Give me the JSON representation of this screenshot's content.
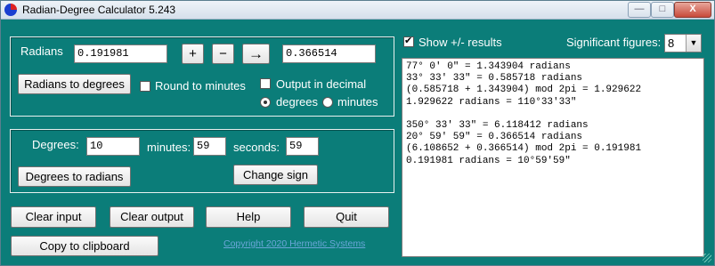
{
  "window": {
    "title": "Radian-Degree Calculator 5.243",
    "minimize": "—",
    "maximize": "□",
    "close": "X"
  },
  "radians_panel": {
    "label": "Radians",
    "input_value": "0.191981",
    "plus_label": "+",
    "minus_label": "−",
    "arrow_label": "→",
    "result_value": "0.366514",
    "convert_button": "Radians to degrees",
    "round_to_minutes": "Round to minutes",
    "output_in_decimal": "Output in decimal",
    "radio_degrees": "degrees",
    "radio_minutes": "minutes"
  },
  "degrees_panel": {
    "degrees_label": "Degrees:",
    "degrees_value": "10",
    "minutes_label": "minutes:",
    "minutes_value": "59",
    "seconds_label": "seconds:",
    "seconds_value": "59",
    "convert_button": "Degrees to radians",
    "change_sign_button": "Change sign"
  },
  "bottom_buttons": {
    "clear_input": "Clear input",
    "clear_output": "Clear output",
    "help": "Help",
    "quit": "Quit",
    "copy": "Copy to clipboard",
    "copyright": "Copyright 2020 Hermetic Systems"
  },
  "options": {
    "show_results": "Show +/- results",
    "sig_figs_label": "Significant figures:",
    "sig_figs_value": "8"
  },
  "output_lines": [
    "77° 0' 0\" = 1.343904 radians",
    "33° 33' 33\" = 0.585718 radians",
    "(0.585718 + 1.343904) mod 2pi = 1.929622",
    "1.929622 radians = 110°33'33\"",
    "",
    "350° 33' 33\" = 6.118412 radians",
    "20° 59' 59\" = 0.366514 radians",
    "(6.108652 + 0.366514) mod 2pi = 0.191981",
    "0.191981 radians = 10°59'59\""
  ]
}
